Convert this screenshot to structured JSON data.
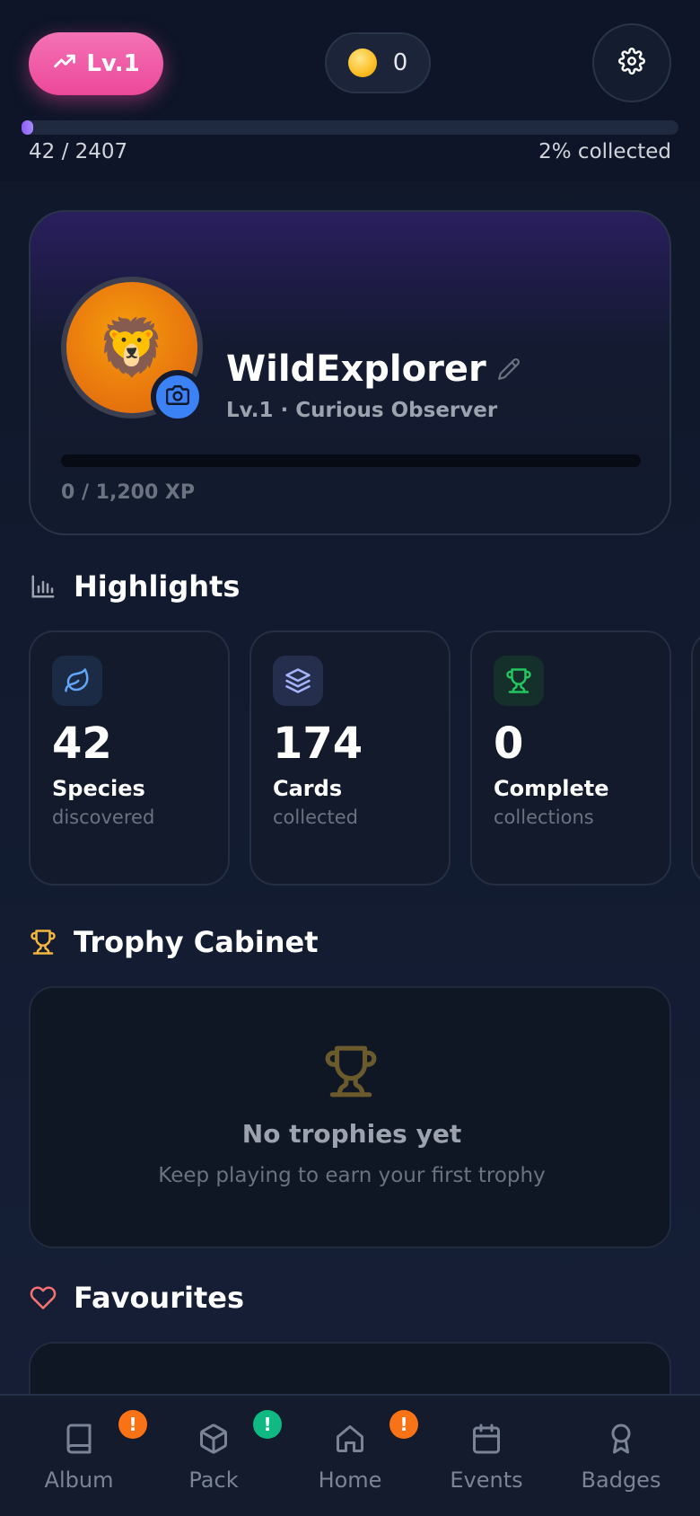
{
  "header": {
    "level_label": "Lv.1",
    "coins": "0",
    "progress_left": "42 / 2407",
    "progress_right": "2% collected",
    "progress_fraction": 0.0174
  },
  "profile": {
    "avatar_emoji": "🦁",
    "username": "WildExplorer",
    "subtitle": "Lv.1 · Curious Observer",
    "xp_label": "0 / 1,200 XP",
    "xp_fraction": 0
  },
  "highlights": {
    "title": "Highlights",
    "cards": [
      {
        "value": "42",
        "label": "Species",
        "sub": "discovered",
        "icon": "leaf-icon",
        "color": "#60a5fa",
        "icon_bg": "#1c2b45"
      },
      {
        "value": "174",
        "label": "Cards",
        "sub": "collected",
        "icon": "layers-icon",
        "color": "#a5b4fc",
        "icon_bg": "#252e4d"
      },
      {
        "value": "0",
        "label": "Complete",
        "sub": "collections",
        "icon": "trophy-icon",
        "color": "#22c55e",
        "icon_bg": "#15302a"
      }
    ]
  },
  "trophies": {
    "title": "Trophy Cabinet",
    "empty_title": "No trophies yet",
    "empty_sub": "Keep playing to earn your first trophy"
  },
  "favourites": {
    "title": "Favourites"
  },
  "nav": {
    "items": [
      {
        "label": "Album",
        "icon": "album-icon",
        "badge": "!",
        "badge_color": "#f97316"
      },
      {
        "label": "Pack",
        "icon": "package-icon",
        "badge": "!",
        "badge_color": "#10b981"
      },
      {
        "label": "Home",
        "icon": "home-icon",
        "badge": "!",
        "badge_color": "#f97316"
      },
      {
        "label": "Events",
        "icon": "calendar-icon",
        "badge": "",
        "badge_color": ""
      },
      {
        "label": "Badges",
        "icon": "award-icon",
        "badge": "",
        "badge_color": ""
      }
    ]
  },
  "colors": {
    "accent_pink": "#ec4899",
    "accent_purple": "#8b5cf6",
    "trophy_gold": "#f4b63f",
    "favourite_red": "#f87171"
  }
}
